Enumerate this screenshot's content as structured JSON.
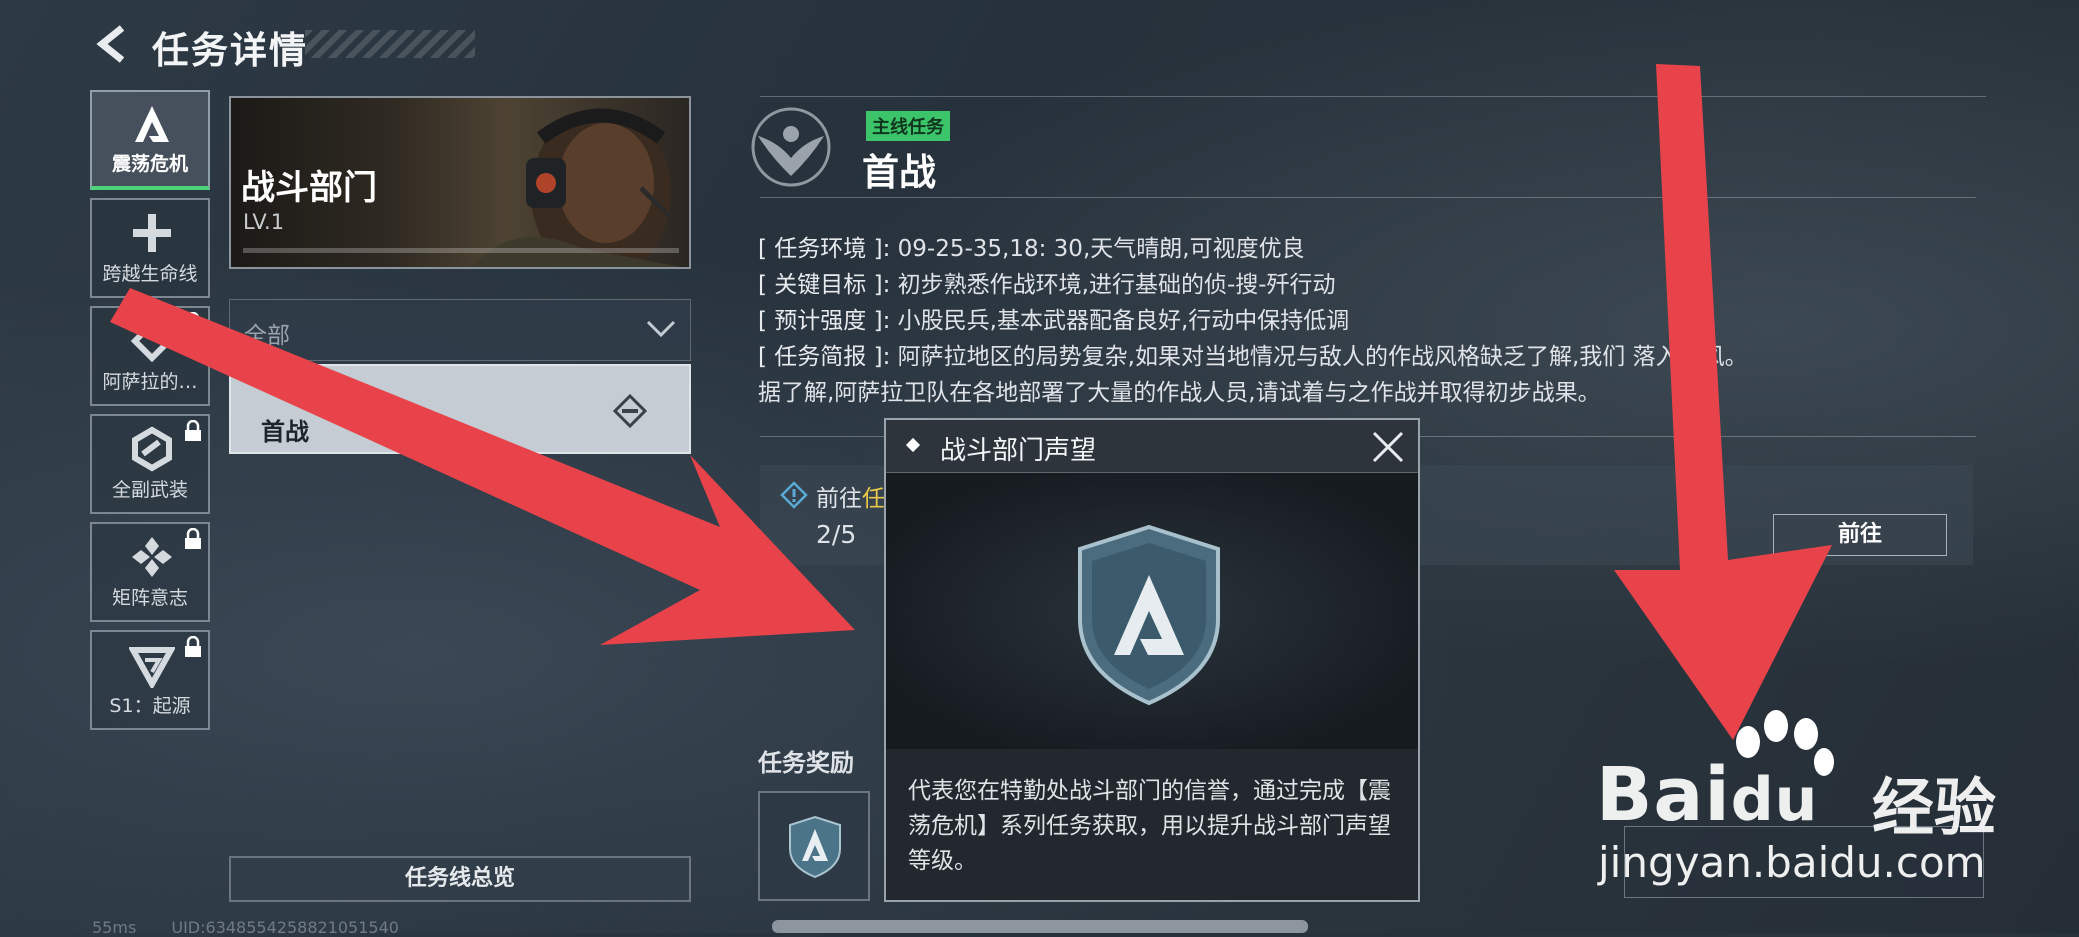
{
  "header": {
    "title": "任务详情",
    "back_icon": "back-arrow-icon"
  },
  "sidebar": {
    "items": [
      {
        "label": "震荡危机",
        "icon": "a-logo-icon",
        "locked": false,
        "active": true
      },
      {
        "label": "跨越生命线",
        "icon": "plus-icon",
        "locked": false,
        "active": false
      },
      {
        "label": "阿萨拉的…",
        "icon": "diamond-icon",
        "locked": true,
        "active": false
      },
      {
        "label": "全副武装",
        "icon": "hexagon-icon",
        "locked": true,
        "active": false
      },
      {
        "label": "矩阵意志",
        "icon": "matrix-icon",
        "locked": true,
        "active": false
      },
      {
        "label": "S1：起源",
        "icon": "triangle-icon",
        "locked": true,
        "active": false
      }
    ]
  },
  "department": {
    "name": "战斗部门",
    "level": "LV.1"
  },
  "filter": {
    "selected": "全部"
  },
  "mission_list": [
    {
      "name": "首战"
    }
  ],
  "overview_button": "任务线总览",
  "status_bar": {
    "ping": "55ms",
    "uid": "UID:6348554258821051540"
  },
  "mission": {
    "tag": "主线任务",
    "title": "首战",
    "details": [
      {
        "key": "[ 任务环境 ]:",
        "value": "09-25-35,18: 30,天气晴朗,可视度优良"
      },
      {
        "key": "[ 关键目标 ]:",
        "value": "初步熟悉作战环境,进行基础的侦-搜-歼行动"
      },
      {
        "key": "[ 预计强度 ]:",
        "value": "小股民兵,基本武器配备良好,行动中保持低调"
      },
      {
        "key": "[ 任务简报 ]:",
        "value": "阿萨拉地区的局势复杂,如果对当地情况与敌人的作战风格缺乏了解,我们"
      }
    ],
    "brief_tail": "落入下风。",
    "brief_line2": "据了解,阿萨拉卫队在各地部署了大量的作战人员,请试着与之作战并取得初步战果。",
    "goal_prefix": "前往",
    "goal_highlight": "任",
    "progress": "2/5",
    "goto_button": "前往",
    "reward_title": "任务奖励"
  },
  "popup": {
    "title": "战斗部门声望",
    "description": "代表您在特勤处战斗部门的信誉，通过完成【震荡危机】系列任务获取，用以提升战斗部门声望等级。"
  },
  "watermark": {
    "brand": "Bai",
    "brand_du": "du",
    "brand_cn": "经验",
    "url": "jingyan.baidu.com"
  },
  "colors": {
    "accent_green": "#3cc46b",
    "arrow_red": "#e8434a",
    "highlight_yellow": "#e8c84a"
  }
}
